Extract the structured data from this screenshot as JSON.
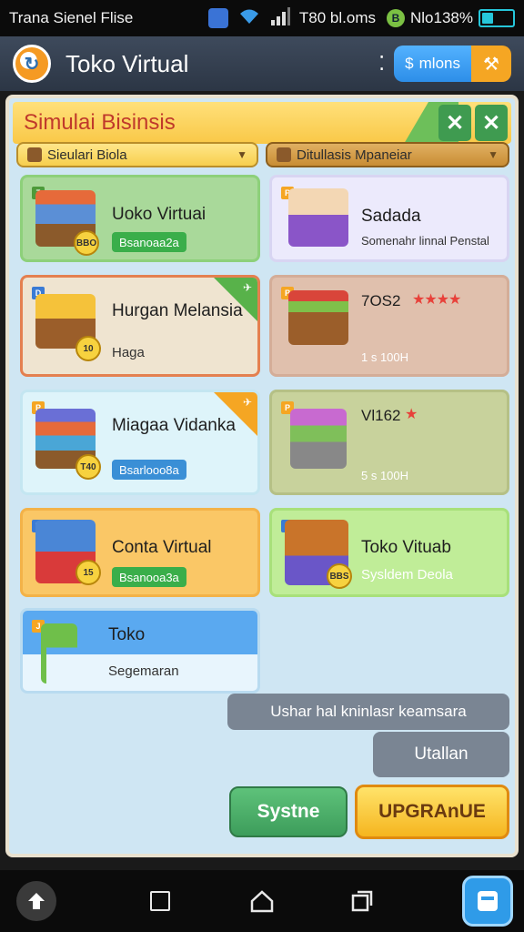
{
  "status_bar": {
    "left_text": "Trana Sienel Flise",
    "time_text": "T80 bl.oms",
    "battery_text": "Nlo138%",
    "battery_level": 0.38
  },
  "app_bar": {
    "title": "Toko Virtual",
    "pill_label": "mlons",
    "pill_icon": "coin-icon",
    "action_icon": "hammer-icon"
  },
  "panel": {
    "title": "Simulai Bisinsis",
    "dropdown_left": "Sieulari Biola",
    "dropdown_right": "Ditullasis Mpaneiar",
    "close_label": "✕"
  },
  "cards": [
    {
      "title": "Uoko Virtuai",
      "tag": "Bsanoaa2a",
      "coin": "BBO",
      "corner": "7",
      "accent": "#8dd07a",
      "bg": "#a9d99a"
    },
    {
      "title": "Sadada",
      "subtitle": "Somenahr linnal Penstal",
      "corner": "P",
      "accent": "#e5e3fb",
      "bg": "#eceafc"
    },
    {
      "title": "Hurgan Melansia",
      "subtitle": "Haga",
      "coin": "10",
      "corner": "D",
      "accent": "#e8dcc8",
      "bg": "#efe4d0"
    },
    {
      "title": "7OS2",
      "subtitle": "1 s 100H",
      "stars": "★★★★",
      "corner": "P",
      "accent": "#dcb9a7",
      "bg": "#e0c0ad"
    },
    {
      "title": "Miagaa Vidanka",
      "tag": "Bsarlooo8a",
      "coin": "T40",
      "corner": "P",
      "accent": "#d6f0f8",
      "bg": "#def4fa"
    },
    {
      "title": "Vl162",
      "subtitle": "5 s 100H",
      "stars": "★",
      "corner": "P",
      "accent": "#c2cc96",
      "bg": "#c8d29c"
    },
    {
      "title": "Conta Virtual",
      "tag": "Bsanooa3a",
      "coin": "15",
      "corner": "B",
      "accent": "#f8c05a",
      "bg": "#fac766"
    },
    {
      "title": "Toko Vituab",
      "subtitle": "Sysldem Deola",
      "coin": "BBS",
      "corner": "9",
      "accent": "#b8ea90",
      "bg": "#c0ed98"
    },
    {
      "title": "Toko",
      "subtitle": "Segemaran",
      "corner": "J",
      "accent": "#5aa9f0",
      "bg": "#e8f5fd"
    }
  ],
  "toasts": {
    "primary": "Ushar hal kninlasr keamsara",
    "secondary": "Utallan"
  },
  "buttons": {
    "system": "Systne",
    "upgrade": "UPGRAnUE"
  },
  "colors": {
    "accent_orange": "#f5a623",
    "accent_green": "#3f9b50",
    "panel_bg": "#cfe6f3",
    "header_yellow": "#f9c847",
    "title_red": "#c0392b"
  }
}
